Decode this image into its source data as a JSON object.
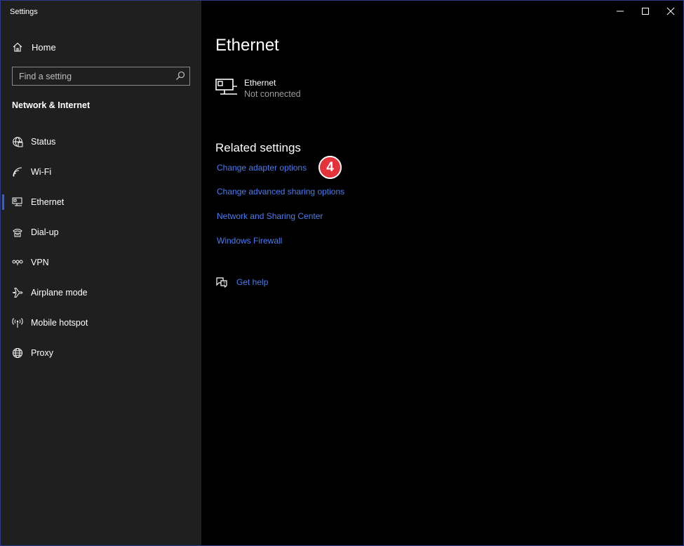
{
  "window": {
    "title": "Settings"
  },
  "sidebar": {
    "home_label": "Home",
    "search_placeholder": "Find a setting",
    "section_title": "Network & Internet",
    "items": [
      {
        "label": "Status",
        "icon": "globe-status-icon"
      },
      {
        "label": "Wi-Fi",
        "icon": "wifi-icon"
      },
      {
        "label": "Ethernet",
        "icon": "ethernet-icon",
        "selected": true
      },
      {
        "label": "Dial-up",
        "icon": "dialup-icon"
      },
      {
        "label": "VPN",
        "icon": "vpn-icon"
      },
      {
        "label": "Airplane mode",
        "icon": "airplane-icon"
      },
      {
        "label": "Mobile hotspot",
        "icon": "hotspot-icon"
      },
      {
        "label": "Proxy",
        "icon": "globe-icon"
      }
    ]
  },
  "main": {
    "title": "Ethernet",
    "device": {
      "name": "Ethernet",
      "status": "Not connected"
    },
    "related": {
      "title": "Related settings",
      "links": [
        "Change adapter options",
        "Change advanced sharing options",
        "Network and Sharing Center",
        "Windows Firewall"
      ]
    },
    "badge": "4",
    "help_label": "Get help"
  },
  "colors": {
    "accent": "#2d5fd6",
    "link": "#4a7df0",
    "badge": "#e4323b",
    "sidebar_bg": "#1f1f1f",
    "main_bg": "#000000"
  }
}
